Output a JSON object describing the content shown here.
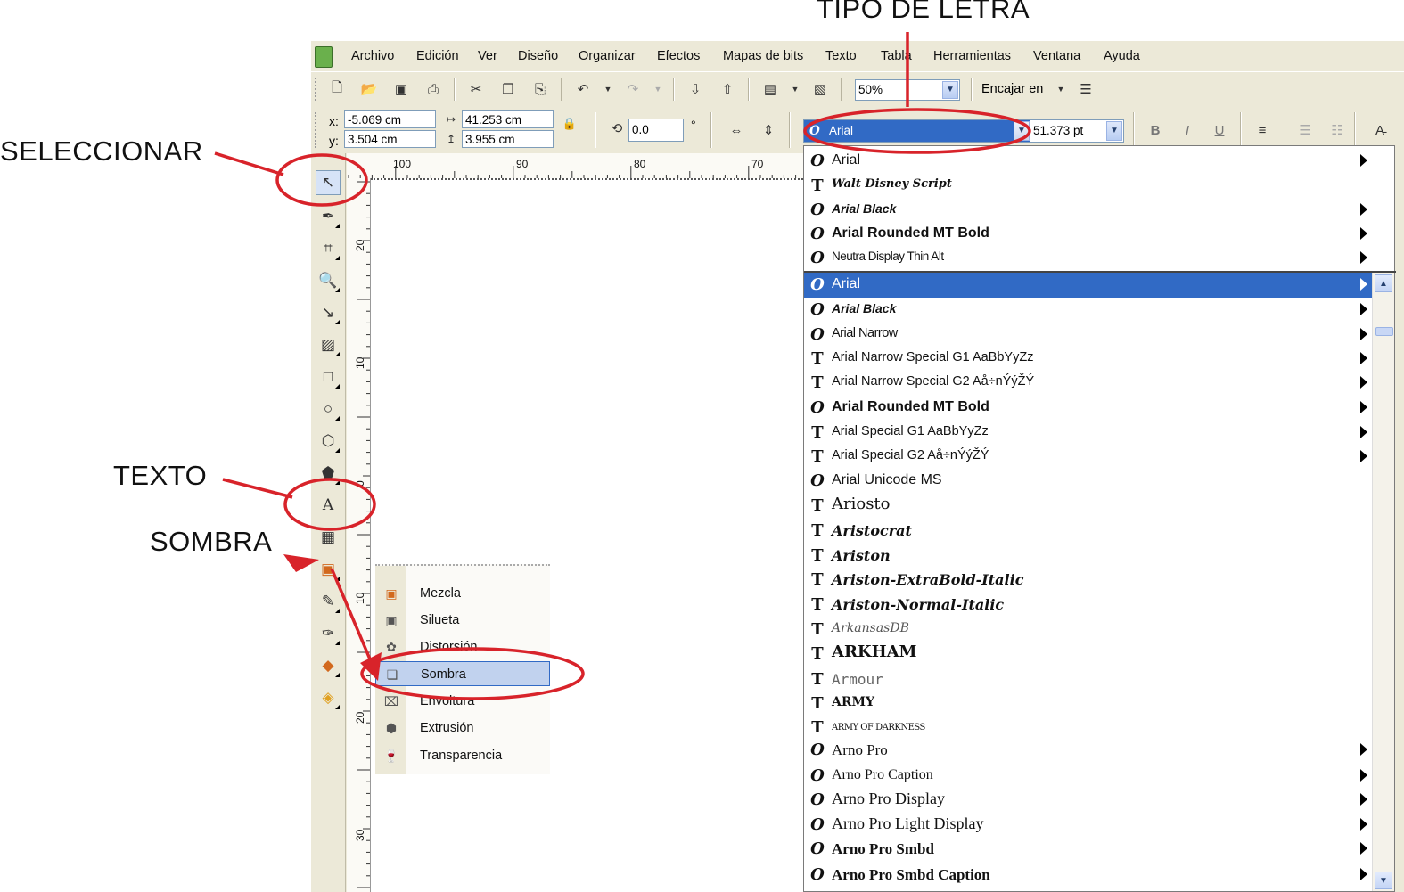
{
  "callouts": {
    "font_type": "TIPO DE LETRA",
    "select": "SELECCIONAR",
    "text": "TEXTO",
    "shadow": "SOMBRA"
  },
  "menubar": [
    "Archivo",
    "Edición",
    "Ver",
    "Diseño",
    "Organizar",
    "Efectos",
    "Mapas de bits",
    "Texto",
    "Tabla",
    "Herramientas",
    "Ventana",
    "Ayuda"
  ],
  "toolbar": {
    "zoom": "50%",
    "fit_label": "Encajar en"
  },
  "properties": {
    "x_label": "x:",
    "x_value": "-5.069 cm",
    "y_label": "y:",
    "y_value": "3.504 cm",
    "width": "41.253 cm",
    "height": "3.955 cm",
    "rotation": "0.0",
    "degree": "°",
    "font": "Arial",
    "font_size": "51.373 pt"
  },
  "rulers": {
    "h_ticks": [
      "100",
      "90",
      "80",
      "70"
    ],
    "v_ticks": [
      "20",
      "10",
      "0",
      "10",
      "20",
      "30"
    ]
  },
  "flyout": [
    "Mezcla",
    "Silueta",
    "Distorsión",
    "Sombra",
    "Envoltura",
    "Extrusión",
    "Transparencia"
  ],
  "flyout_selected": "Sombra",
  "font_list": {
    "recent": [
      {
        "name": "Arial",
        "type": "O",
        "sub": true
      },
      {
        "name": "Walt Disney Script",
        "type": "T",
        "sub": false
      },
      {
        "name": "Arial Black",
        "type": "O",
        "sub": true
      },
      {
        "name": "Arial Rounded MT Bold",
        "type": "O",
        "sub": true
      },
      {
        "name": "Neutra Display Thin Alt",
        "type": "O",
        "sub": true
      }
    ],
    "all": [
      {
        "name": "Arial",
        "type": "O",
        "sub": true,
        "selected": true
      },
      {
        "name": "Arial Black",
        "type": "O",
        "sub": true
      },
      {
        "name": "Arial Narrow",
        "type": "O",
        "sub": true
      },
      {
        "name": "Arial Narrow Special G1 AaBbYyZz",
        "type": "T",
        "sub": true
      },
      {
        "name": "Arial Narrow Special G2 Aå÷nÝýŽÝ",
        "type": "T",
        "sub": true
      },
      {
        "name": "Arial Rounded MT Bold",
        "type": "O",
        "sub": true
      },
      {
        "name": "Arial Special G1 AaBbYyZz",
        "type": "T",
        "sub": true
      },
      {
        "name": "Arial Special G2 Aå÷nÝýŽÝ",
        "type": "T",
        "sub": true
      },
      {
        "name": "Arial Unicode MS",
        "type": "O",
        "sub": false
      },
      {
        "name": "Ariosto",
        "type": "T",
        "sub": false
      },
      {
        "name": "Aristocrat",
        "type": "T",
        "sub": false
      },
      {
        "name": "Ariston",
        "type": "T",
        "sub": false
      },
      {
        "name": "Ariston-ExtraBold-Italic",
        "type": "T",
        "sub": false
      },
      {
        "name": "Ariston-Normal-Italic",
        "type": "T",
        "sub": false
      },
      {
        "name": "ArkansasDB",
        "type": "T",
        "sub": false
      },
      {
        "name": "ARKHAM",
        "type": "T",
        "sub": false
      },
      {
        "name": "Armour",
        "type": "T",
        "sub": false
      },
      {
        "name": "ARMY",
        "type": "T",
        "sub": false
      },
      {
        "name": "ARMY OF DARKNESS",
        "type": "T",
        "sub": false
      },
      {
        "name": "Arno Pro",
        "type": "O",
        "sub": true
      },
      {
        "name": "Arno Pro Caption",
        "type": "O",
        "sub": true
      },
      {
        "name": "Arno Pro Display",
        "type": "O",
        "sub": true
      },
      {
        "name": "Arno Pro Light Display",
        "type": "O",
        "sub": true
      },
      {
        "name": "Arno Pro Smbd",
        "type": "O",
        "sub": true
      },
      {
        "name": "Arno Pro Smbd Caption",
        "type": "O",
        "sub": true
      }
    ]
  },
  "colors": {
    "annotation": "#d8232a",
    "selection": "#316ac5",
    "chrome": "#ece9d8"
  }
}
